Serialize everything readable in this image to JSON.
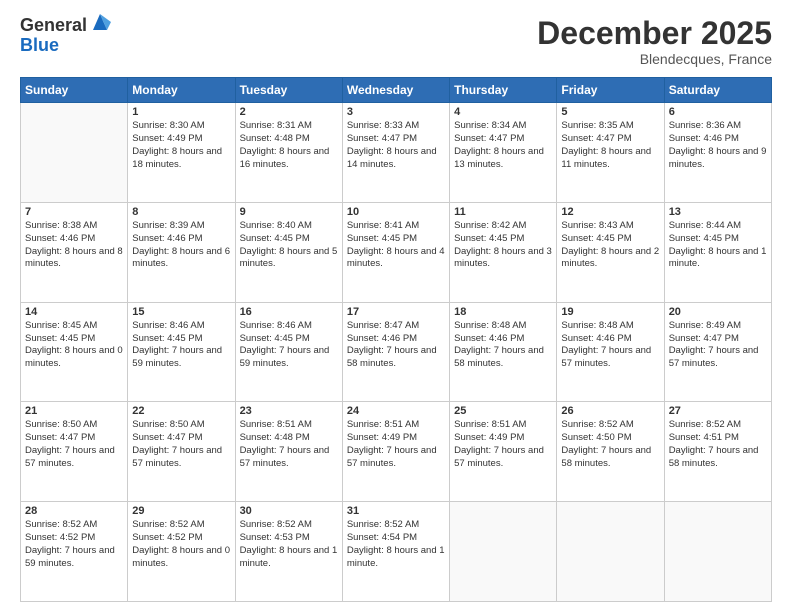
{
  "logo": {
    "general": "General",
    "blue": "Blue"
  },
  "header": {
    "month": "December 2025",
    "location": "Blendecques, France"
  },
  "weekdays": [
    "Sunday",
    "Monday",
    "Tuesday",
    "Wednesday",
    "Thursday",
    "Friday",
    "Saturday"
  ],
  "weeks": [
    [
      {
        "day": "",
        "sunrise": "",
        "sunset": "",
        "daylight": ""
      },
      {
        "day": "1",
        "sunrise": "Sunrise: 8:30 AM",
        "sunset": "Sunset: 4:49 PM",
        "daylight": "Daylight: 8 hours and 18 minutes."
      },
      {
        "day": "2",
        "sunrise": "Sunrise: 8:31 AM",
        "sunset": "Sunset: 4:48 PM",
        "daylight": "Daylight: 8 hours and 16 minutes."
      },
      {
        "day": "3",
        "sunrise": "Sunrise: 8:33 AM",
        "sunset": "Sunset: 4:47 PM",
        "daylight": "Daylight: 8 hours and 14 minutes."
      },
      {
        "day": "4",
        "sunrise": "Sunrise: 8:34 AM",
        "sunset": "Sunset: 4:47 PM",
        "daylight": "Daylight: 8 hours and 13 minutes."
      },
      {
        "day": "5",
        "sunrise": "Sunrise: 8:35 AM",
        "sunset": "Sunset: 4:47 PM",
        "daylight": "Daylight: 8 hours and 11 minutes."
      },
      {
        "day": "6",
        "sunrise": "Sunrise: 8:36 AM",
        "sunset": "Sunset: 4:46 PM",
        "daylight": "Daylight: 8 hours and 9 minutes."
      }
    ],
    [
      {
        "day": "7",
        "sunrise": "Sunrise: 8:38 AM",
        "sunset": "Sunset: 4:46 PM",
        "daylight": "Daylight: 8 hours and 8 minutes."
      },
      {
        "day": "8",
        "sunrise": "Sunrise: 8:39 AM",
        "sunset": "Sunset: 4:46 PM",
        "daylight": "Daylight: 8 hours and 6 minutes."
      },
      {
        "day": "9",
        "sunrise": "Sunrise: 8:40 AM",
        "sunset": "Sunset: 4:45 PM",
        "daylight": "Daylight: 8 hours and 5 minutes."
      },
      {
        "day": "10",
        "sunrise": "Sunrise: 8:41 AM",
        "sunset": "Sunset: 4:45 PM",
        "daylight": "Daylight: 8 hours and 4 minutes."
      },
      {
        "day": "11",
        "sunrise": "Sunrise: 8:42 AM",
        "sunset": "Sunset: 4:45 PM",
        "daylight": "Daylight: 8 hours and 3 minutes."
      },
      {
        "day": "12",
        "sunrise": "Sunrise: 8:43 AM",
        "sunset": "Sunset: 4:45 PM",
        "daylight": "Daylight: 8 hours and 2 minutes."
      },
      {
        "day": "13",
        "sunrise": "Sunrise: 8:44 AM",
        "sunset": "Sunset: 4:45 PM",
        "daylight": "Daylight: 8 hours and 1 minute."
      }
    ],
    [
      {
        "day": "14",
        "sunrise": "Sunrise: 8:45 AM",
        "sunset": "Sunset: 4:45 PM",
        "daylight": "Daylight: 8 hours and 0 minutes."
      },
      {
        "day": "15",
        "sunrise": "Sunrise: 8:46 AM",
        "sunset": "Sunset: 4:45 PM",
        "daylight": "Daylight: 7 hours and 59 minutes."
      },
      {
        "day": "16",
        "sunrise": "Sunrise: 8:46 AM",
        "sunset": "Sunset: 4:45 PM",
        "daylight": "Daylight: 7 hours and 59 minutes."
      },
      {
        "day": "17",
        "sunrise": "Sunrise: 8:47 AM",
        "sunset": "Sunset: 4:46 PM",
        "daylight": "Daylight: 7 hours and 58 minutes."
      },
      {
        "day": "18",
        "sunrise": "Sunrise: 8:48 AM",
        "sunset": "Sunset: 4:46 PM",
        "daylight": "Daylight: 7 hours and 58 minutes."
      },
      {
        "day": "19",
        "sunrise": "Sunrise: 8:48 AM",
        "sunset": "Sunset: 4:46 PM",
        "daylight": "Daylight: 7 hours and 57 minutes."
      },
      {
        "day": "20",
        "sunrise": "Sunrise: 8:49 AM",
        "sunset": "Sunset: 4:47 PM",
        "daylight": "Daylight: 7 hours and 57 minutes."
      }
    ],
    [
      {
        "day": "21",
        "sunrise": "Sunrise: 8:50 AM",
        "sunset": "Sunset: 4:47 PM",
        "daylight": "Daylight: 7 hours and 57 minutes."
      },
      {
        "day": "22",
        "sunrise": "Sunrise: 8:50 AM",
        "sunset": "Sunset: 4:47 PM",
        "daylight": "Daylight: 7 hours and 57 minutes."
      },
      {
        "day": "23",
        "sunrise": "Sunrise: 8:51 AM",
        "sunset": "Sunset: 4:48 PM",
        "daylight": "Daylight: 7 hours and 57 minutes."
      },
      {
        "day": "24",
        "sunrise": "Sunrise: 8:51 AM",
        "sunset": "Sunset: 4:49 PM",
        "daylight": "Daylight: 7 hours and 57 minutes."
      },
      {
        "day": "25",
        "sunrise": "Sunrise: 8:51 AM",
        "sunset": "Sunset: 4:49 PM",
        "daylight": "Daylight: 7 hours and 57 minutes."
      },
      {
        "day": "26",
        "sunrise": "Sunrise: 8:52 AM",
        "sunset": "Sunset: 4:50 PM",
        "daylight": "Daylight: 7 hours and 58 minutes."
      },
      {
        "day": "27",
        "sunrise": "Sunrise: 8:52 AM",
        "sunset": "Sunset: 4:51 PM",
        "daylight": "Daylight: 7 hours and 58 minutes."
      }
    ],
    [
      {
        "day": "28",
        "sunrise": "Sunrise: 8:52 AM",
        "sunset": "Sunset: 4:52 PM",
        "daylight": "Daylight: 7 hours and 59 minutes."
      },
      {
        "day": "29",
        "sunrise": "Sunrise: 8:52 AM",
        "sunset": "Sunset: 4:52 PM",
        "daylight": "Daylight: 8 hours and 0 minutes."
      },
      {
        "day": "30",
        "sunrise": "Sunrise: 8:52 AM",
        "sunset": "Sunset: 4:53 PM",
        "daylight": "Daylight: 8 hours and 1 minute."
      },
      {
        "day": "31",
        "sunrise": "Sunrise: 8:52 AM",
        "sunset": "Sunset: 4:54 PM",
        "daylight": "Daylight: 8 hours and 1 minute."
      },
      {
        "day": "",
        "sunrise": "",
        "sunset": "",
        "daylight": ""
      },
      {
        "day": "",
        "sunrise": "",
        "sunset": "",
        "daylight": ""
      },
      {
        "day": "",
        "sunrise": "",
        "sunset": "",
        "daylight": ""
      }
    ]
  ]
}
